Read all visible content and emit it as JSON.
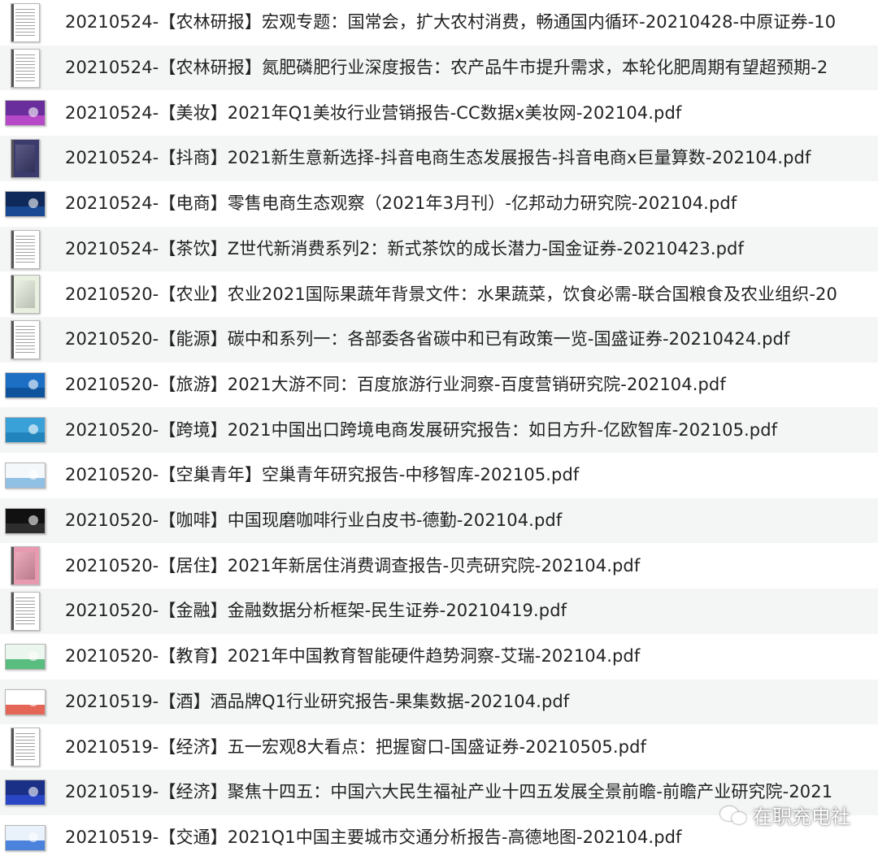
{
  "files": [
    {
      "name": "20210524-【农林研报】宏观专题：国常会，扩大农村消费，畅通国内循环-20210428-中原证券-10",
      "thumb": "portrait-text",
      "color": "#ffffff"
    },
    {
      "name": "20210524-【农林研报】氮肥磷肥行业深度报告：农产品牛市提升需求，本轮化肥周期有望超预期-2",
      "thumb": "portrait-text",
      "color": "#ffffff"
    },
    {
      "name": "20210524-【美妆】2021年Q1美妆行业营销报告-CC数据x美妆网-202104.pdf",
      "thumb": "landscape",
      "color": "#6a2d9c",
      "band": "#c24fd0"
    },
    {
      "name": "20210524-【抖商】2021新生意新选择-抖音电商生态发展报告-抖音电商x巨量算数-202104.pdf",
      "thumb": "portrait-image",
      "color": "#3b3b6e"
    },
    {
      "name": "20210524-【电商】零售电商生态观察（2021年3月刊）-亿邦动力研究院-202104.pdf",
      "thumb": "landscape",
      "color": "#0f2a5a",
      "band": "#1a4f9c"
    },
    {
      "name": "20210524-【茶饮】Z世代新消费系列2：新式茶饮的成长潜力-国金证券-20210423.pdf",
      "thumb": "portrait-text",
      "color": "#ffffff"
    },
    {
      "name": "20210520-【农业】农业2021国际果蔬年背景文件：水果蔬菜，饮食必需-联合国粮食及农业组织-20",
      "thumb": "portrait-image",
      "color": "#e8f0e0"
    },
    {
      "name": "20210520-【能源】碳中和系列一：各部委各省碳中和已有政策一览-国盛证券-20210424.pdf",
      "thumb": "portrait-text",
      "color": "#ffffff"
    },
    {
      "name": "20210520-【旅游】2021大游不同：百度旅游行业洞察-百度营销研究院-202104.pdf",
      "thumb": "landscape",
      "color": "#1d6fc4",
      "band": "#0d4f96"
    },
    {
      "name": "20210520-【跨境】2021中国出口跨境电商发展研究报告：如日方升-亿欧智库-202105.pdf",
      "thumb": "landscape",
      "color": "#3aa0d8",
      "band": "#1f7fb8"
    },
    {
      "name": "20210520-【空巢青年】空巢青年研究报告-中移智库-202105.pdf",
      "thumb": "landscape",
      "color": "#f4f8fb",
      "band": "#7fb6e0"
    },
    {
      "name": "20210520-【咖啡】中国现磨咖啡行业白皮书-德勤-202104.pdf",
      "thumb": "landscape",
      "color": "#111111",
      "band": "#333333"
    },
    {
      "name": "20210520-【居住】2021年新居住消费调查报告-贝壳研究院-202104.pdf",
      "thumb": "portrait-image",
      "color": "#e79ab0"
    },
    {
      "name": "20210520-【金融】金融数据分析框架-民生证券-20210419.pdf",
      "thumb": "portrait-text",
      "color": "#ffffff"
    },
    {
      "name": "20210520-【教育】2021年中国教育智能硬件趋势洞察-艾瑞-202104.pdf",
      "thumb": "landscape",
      "color": "#eaf6ee",
      "band": "#3fb36b"
    },
    {
      "name": "20210519-【酒】酒品牌Q1行业研究报告-果集数据-202104.pdf",
      "thumb": "landscape",
      "color": "#ffffff",
      "band": "#e04a3a"
    },
    {
      "name": "20210519-【经济】五一宏观8大看点：把握窗口-国盛证券-20210505.pdf",
      "thumb": "portrait-text",
      "color": "#ffffff"
    },
    {
      "name": "20210519-【经济】聚焦十四五：中国六大民生福祉产业十四五发展全景前瞻-前瞻产业研究院-2021",
      "thumb": "landscape",
      "color": "#1a2f86",
      "band": "#2d4bd0"
    },
    {
      "name": "20210519-【交通】2021Q1中国主要城市交通分析报告-高德地图-202104.pdf",
      "thumb": "landscape",
      "color": "#e9f1fb",
      "band": "#2f6fd6"
    }
  ],
  "watermark": {
    "text": "在职充电社",
    "icon": "wechat-icon"
  }
}
